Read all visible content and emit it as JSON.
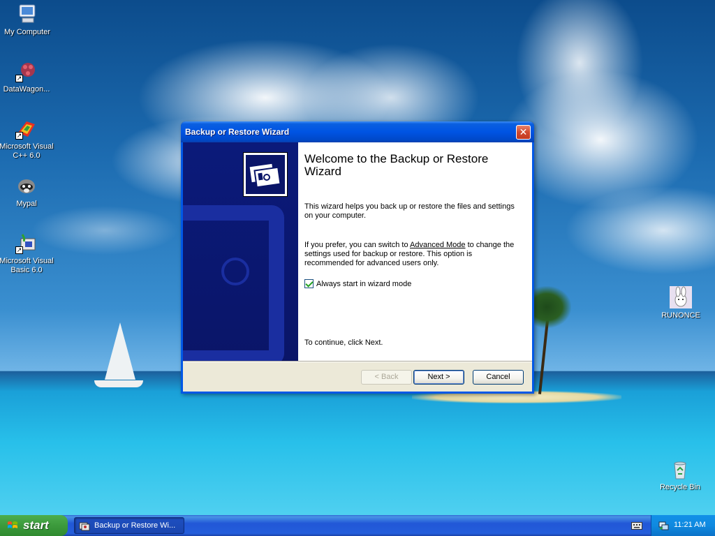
{
  "desktop": {
    "icons": [
      {
        "label": "My Computer",
        "icon": "my-computer-icon"
      },
      {
        "label": "DataWagon...",
        "icon": "datawagon-icon"
      },
      {
        "label": "Microsoft Visual C++ 6.0",
        "icon": "visual-cpp-icon"
      },
      {
        "label": "Mypal",
        "icon": "mypal-icon"
      },
      {
        "label": "Microsoft Visual Basic 6.0",
        "icon": "visual-basic-icon"
      },
      {
        "label": "RUNONCE",
        "icon": "runonce-icon"
      },
      {
        "label": "Recycle Bin",
        "icon": "recycle-bin-icon"
      }
    ]
  },
  "wizard": {
    "title": "Backup or Restore Wizard",
    "close_label": "✕",
    "heading": "Welcome to the Backup or Restore Wizard",
    "intro": "This wizard helps you back up or restore the files and settings on your computer.",
    "advanced_prefix": "If you prefer, you can switch to ",
    "advanced_link": "Advanced Mode",
    "advanced_suffix": " to change the settings used for backup or restore. This option is recommended for advanced users only.",
    "checkbox_label": "Always start in wizard mode",
    "checkbox_checked": true,
    "continue_text": "To continue, click Next.",
    "buttons": {
      "back": "< Back",
      "next": "Next >",
      "cancel": "Cancel"
    }
  },
  "taskbar": {
    "start_label": "start",
    "task_label": "Backup or Restore Wi...",
    "clock": "11:21 AM"
  },
  "colors": {
    "title_bar": "#0054e3",
    "side_banner": "#0a1568",
    "taskbar": "#245edb",
    "start_button": "#3c9a3c"
  }
}
